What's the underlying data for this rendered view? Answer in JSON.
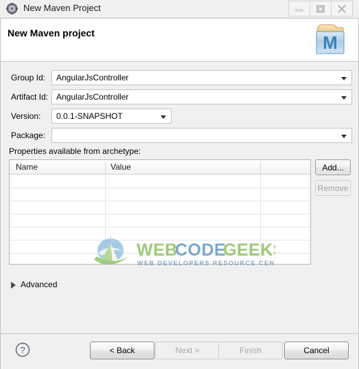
{
  "window": {
    "title": "New Maven Project",
    "icon": "maven-gear-icon",
    "controls": [
      {
        "name": "minimize",
        "glyph": "minimize-icon"
      },
      {
        "name": "restore",
        "glyph": "restore-icon"
      },
      {
        "name": "close",
        "glyph": "close-icon"
      }
    ]
  },
  "header": {
    "title": "New Maven project",
    "icon": "maven-project-icon"
  },
  "form": {
    "fields": [
      {
        "label": "Group Id:",
        "value": "AngularJsController",
        "placeholder": "",
        "type": "combobox",
        "wide": true
      },
      {
        "label": "Artifact Id:",
        "value": "AngularJsController",
        "placeholder": "",
        "type": "combobox",
        "wide": true
      },
      {
        "label": "Version:",
        "value": "0.0.1-SNAPSHOT",
        "placeholder": "",
        "type": "combobox",
        "wide": false
      },
      {
        "label": "Package:",
        "value": "",
        "placeholder": "",
        "type": "combobox",
        "wide": true
      }
    ]
  },
  "properties": {
    "section_label": "Properties available from archetype:",
    "columns": [
      "Name",
      "Value"
    ],
    "rows": [],
    "empty_row_count": 7,
    "buttons": [
      {
        "label": "Add...",
        "enabled": true
      },
      {
        "label": "Remove",
        "enabled": false
      }
    ]
  },
  "advanced": {
    "label": "Advanced",
    "expanded": false
  },
  "watermark": {
    "primary": "WEB CODE GEEKS",
    "secondary": "WEB DEVELOPERS RESOURCE CENTER"
  },
  "footer": {
    "help_label": "?",
    "buttons": [
      {
        "label": "< Back",
        "enabled": true
      },
      {
        "label": "Next >",
        "enabled": false
      },
      {
        "label": "Finish",
        "enabled": false
      },
      {
        "label": "Cancel",
        "enabled": true
      }
    ]
  },
  "colors": {
    "accent": "#4a90c4",
    "watermark_green": "#8cc06a",
    "watermark_blue": "#6c9fc9",
    "dialog_bg": "#f0f0f0",
    "field_bg": "#ffffff"
  }
}
